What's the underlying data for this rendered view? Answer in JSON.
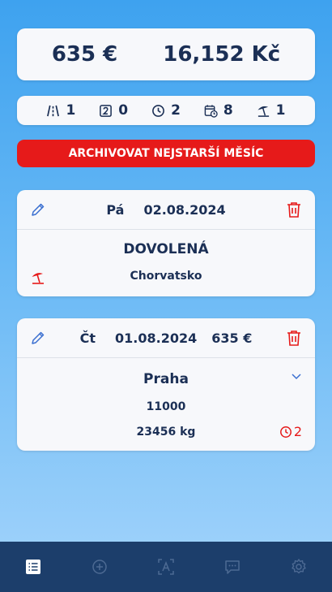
{
  "totals": {
    "eur": "635 €",
    "czk": "16,152 Kč"
  },
  "stats": [
    {
      "icon": "road-icon",
      "value": "1"
    },
    {
      "icon": "number-two-box-icon",
      "value": "0"
    },
    {
      "icon": "clock-icon",
      "value": "2"
    },
    {
      "icon": "calendar-clock-icon",
      "value": "8"
    },
    {
      "icon": "beach-umbrella-icon",
      "value": "1"
    }
  ],
  "archive_button": "ARCHIVOVAT NEJSTARŠÍ MĚSÍC",
  "entries": [
    {
      "day": "Pá",
      "date": "02.08.2024",
      "title": "DOVOLENÁ",
      "subtitle": "Chorvatsko"
    },
    {
      "day": "Čt",
      "date": "01.08.2024",
      "price": "635 €",
      "city": "Praha",
      "number": "11000",
      "weight": "23456 kg",
      "clock_count": "2"
    }
  ],
  "nav": [
    "list-icon",
    "add-circle-icon",
    "scan-text-icon",
    "chat-icon",
    "settings-icon"
  ],
  "colors": {
    "accent_red": "#e61a1a",
    "navy_text": "#1b2f55",
    "nav_bg": "#1c3e6b",
    "icon_blue": "#3a6fd0"
  }
}
